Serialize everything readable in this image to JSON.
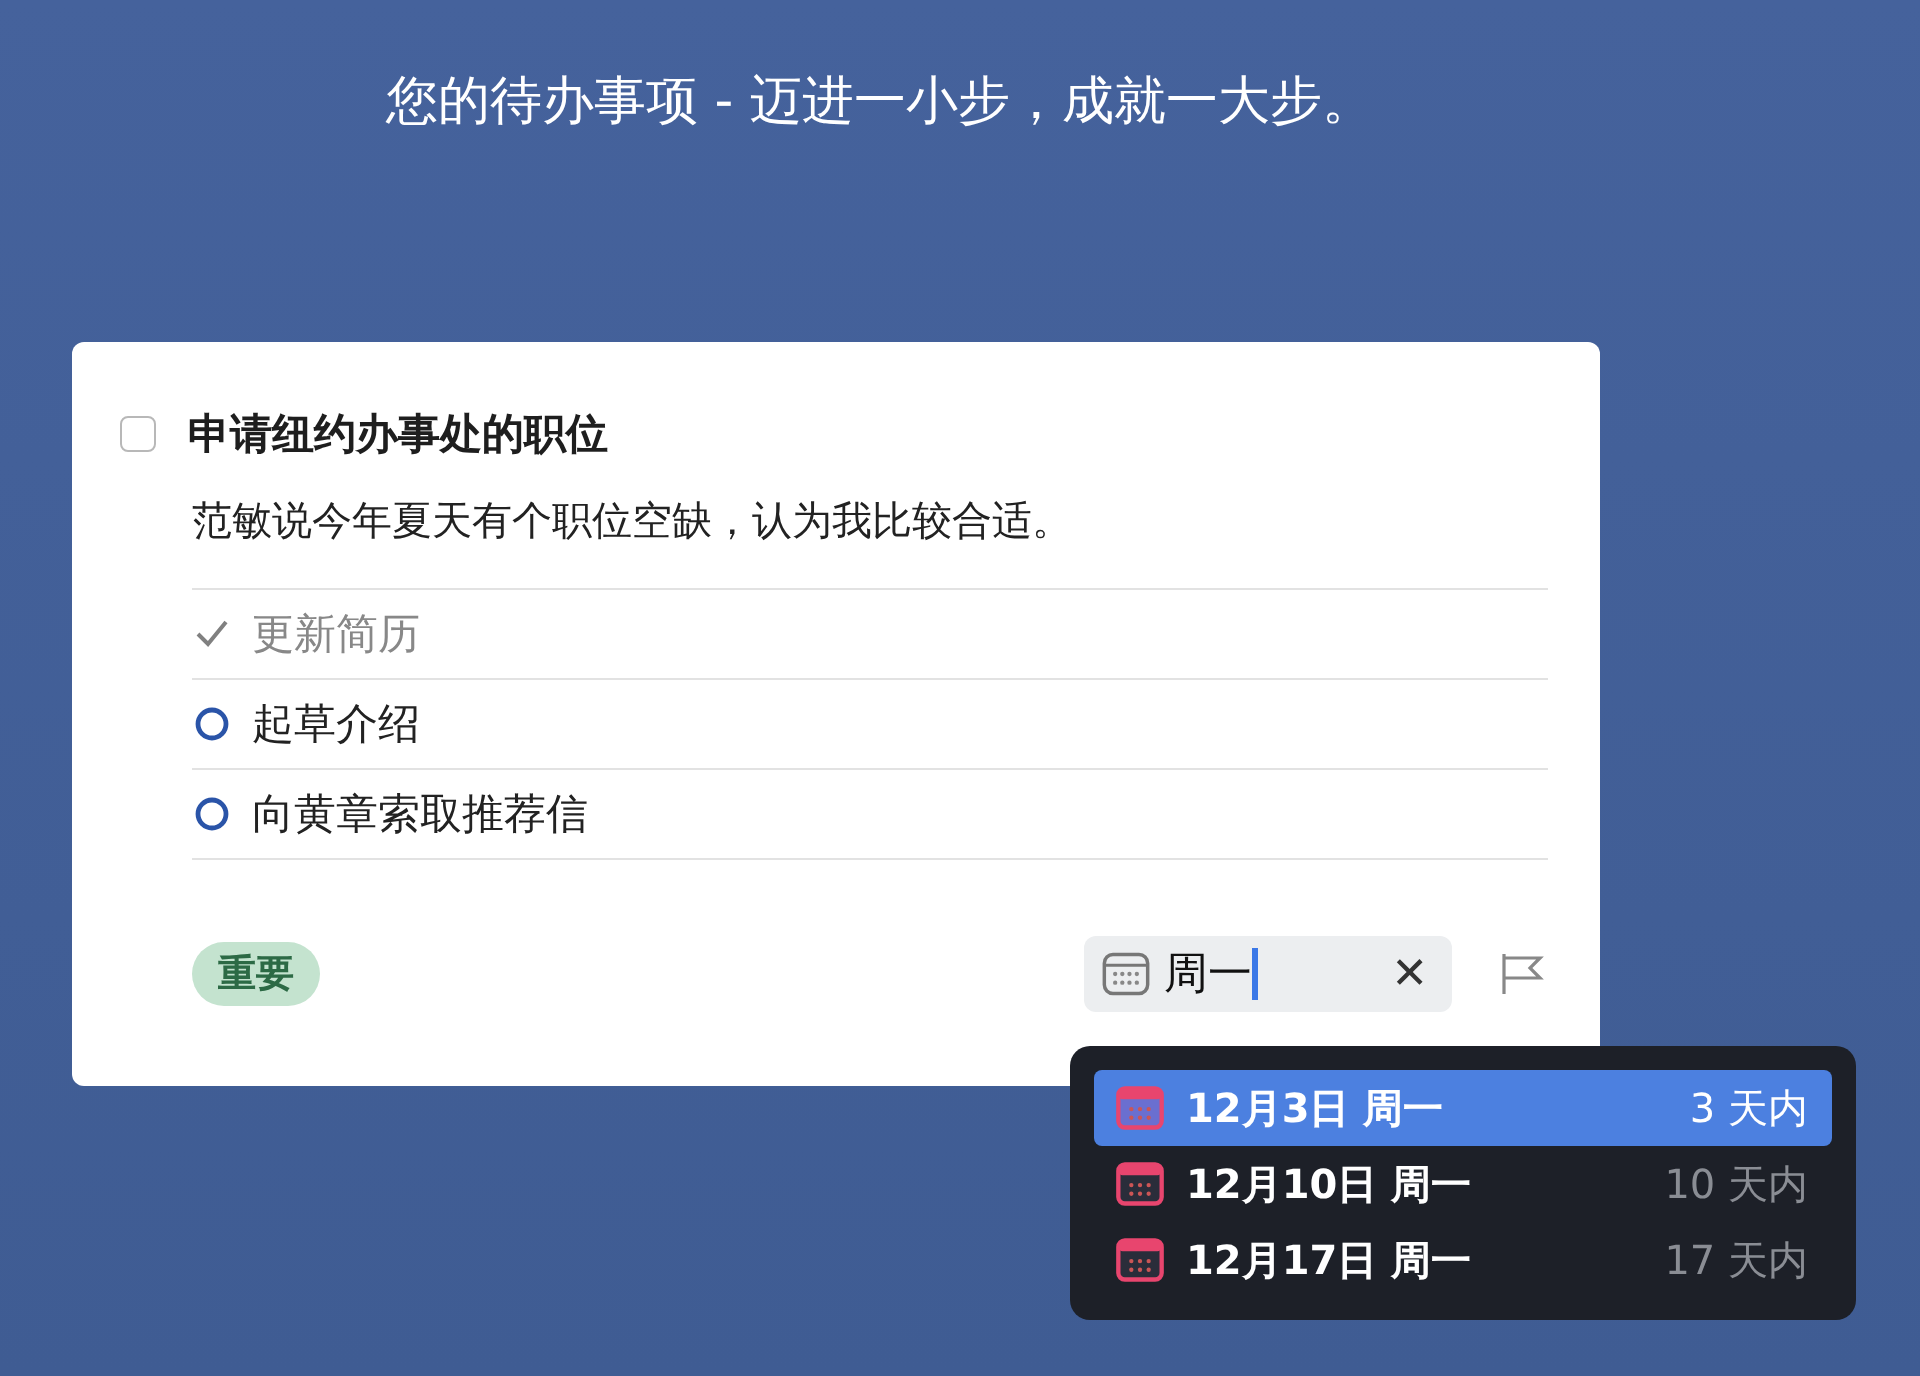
{
  "header": "您的待办事项 - 迈进一小步，成就一大步。",
  "task": {
    "title": "申请纽约办事处的职位",
    "completed": false,
    "note": "范敏说今年夏天有个职位空缺，认为我比较合适。",
    "subtasks": [
      {
        "label": "更新简历",
        "done": true
      },
      {
        "label": "起草介绍",
        "done": false
      },
      {
        "label": "向黄章索取推荐信",
        "done": false
      }
    ],
    "tag": {
      "label": "重要",
      "color": "#c4e3cf"
    },
    "date_field": {
      "value": "周一",
      "clear": "✕"
    },
    "flagged": false
  },
  "date_suggestions": [
    {
      "date": "12月3日 周一",
      "relative": "3 天内",
      "selected": true
    },
    {
      "date": "12月10日 周一",
      "relative": "10 天内",
      "selected": false
    },
    {
      "date": "12月17日 周一",
      "relative": "17 天内",
      "selected": false
    }
  ]
}
